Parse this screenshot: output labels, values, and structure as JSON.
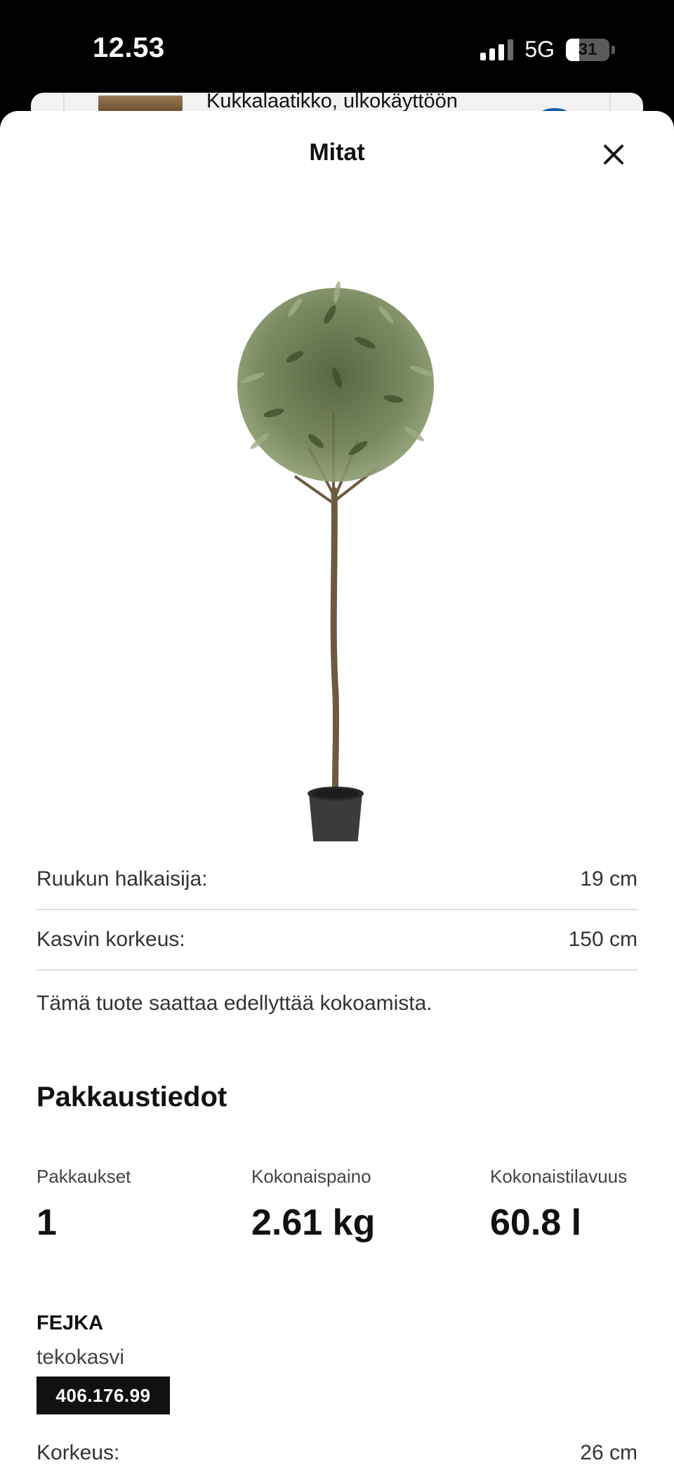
{
  "status_bar": {
    "time": "12.53",
    "network": "5G",
    "battery": "31",
    "battery_level": 0.31
  },
  "background_card": {
    "title": "Kukkalaatikko, ulkokäyttöön"
  },
  "sheet": {
    "title": "Mitat",
    "close_icon": "close-icon"
  },
  "product_image": {
    "icon": "artificial-olive-tree-in-pot"
  },
  "dimensions": [
    {
      "label": "Ruukun halkaisija:",
      "value": "19 cm"
    },
    {
      "label": "Kasvin korkeus:",
      "value": "150 cm"
    }
  ],
  "assembly_note": "Tämä tuote saattaa edellyttää kokoamista.",
  "packaging": {
    "heading": "Pakkaustiedot",
    "packages_label": "Pakkaukset",
    "packages_value": "1",
    "weight_label": "Kokonaispaino",
    "weight_value": "2.61 kg",
    "volume_label": "Kokonaistilavuus",
    "volume_value": "60.8 l"
  },
  "product": {
    "name": "FEJKA",
    "description": "tekokasvi",
    "article_number": "406.176.99"
  },
  "package_detail": {
    "label": "Korkeus:",
    "value": "26 cm"
  }
}
